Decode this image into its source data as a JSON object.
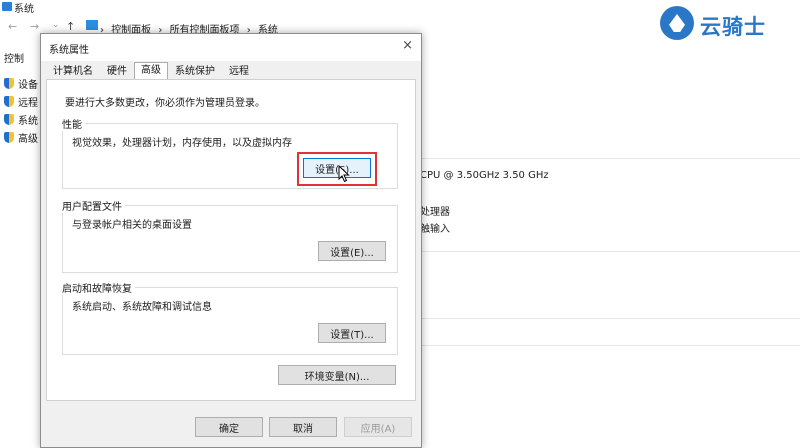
{
  "background": {
    "title": "系统",
    "breadcrumbs": [
      "控制面板",
      "所有控制面板项",
      "系统"
    ],
    "breadcrumb_sep": "›",
    "sidebar_heading": "控制",
    "sidebar_items": [
      "设备",
      "远程",
      "系统",
      "高级"
    ],
    "cpu_text": "CPU @ 3.50GHz   3.50 GHz",
    "processor_text": "处理器",
    "input_text": "触输入"
  },
  "watermark": {
    "text": "云骑士"
  },
  "dialog": {
    "title": "系统属性",
    "close": "×",
    "tabs": [
      "计算机名",
      "硬件",
      "高级",
      "系统保护",
      "远程"
    ],
    "active_tab": 2,
    "admin_note": "要进行大多数更改，你必须作为管理员登录。",
    "performance": {
      "title": "性能",
      "desc": "视觉效果，处理器计划，内存使用，以及虚拟内存",
      "button": "设置(S)..."
    },
    "profiles": {
      "title": "用户配置文件",
      "desc": "与登录帐户相关的桌面设置",
      "button": "设置(E)..."
    },
    "startup": {
      "title": "启动和故障恢复",
      "desc": "系统启动、系统故障和调试信息",
      "button": "设置(T)..."
    },
    "env_button": "环境变量(N)...",
    "ok": "确定",
    "cancel": "取消",
    "apply": "应用(A)"
  },
  "colors": {
    "highlight": "#e23232",
    "accent": "#0078d7",
    "watermark": "#2b77c7"
  }
}
